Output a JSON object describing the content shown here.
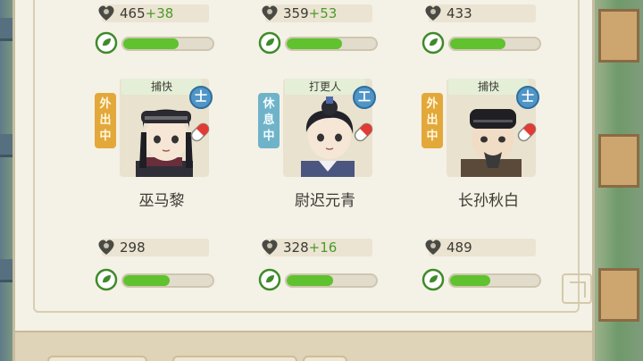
{
  "colors": {
    "bar_fill": "#5fc22e",
    "bonus": "#4c9a2a",
    "rank_badge": "#4f95c7"
  },
  "top_row": [
    {
      "stat": "465",
      "bonus": "+38",
      "bar_fraction": 0.62
    },
    {
      "stat": "359",
      "bonus": "+53",
      "bar_fraction": 0.62
    },
    {
      "stat": "433",
      "bonus": "",
      "bar_fraction": 0.62
    }
  ],
  "characters": [
    {
      "role": "捕快",
      "status": "外出中",
      "status_type": "out",
      "rank": "士",
      "name": "巫马黎",
      "stat": "298",
      "bonus": "",
      "bar_fraction": 0.52
    },
    {
      "role": "打更人",
      "status": "休息中",
      "status_type": "rest",
      "rank": "工",
      "name": "尉迟元青",
      "stat": "328",
      "bonus": "+16",
      "bar_fraction": 0.52
    },
    {
      "role": "捕快",
      "status": "外出中",
      "status_type": "out",
      "rank": "士",
      "name": "长孙秋白",
      "stat": "489",
      "bonus": "",
      "bar_fraction": 0.45
    }
  ]
}
